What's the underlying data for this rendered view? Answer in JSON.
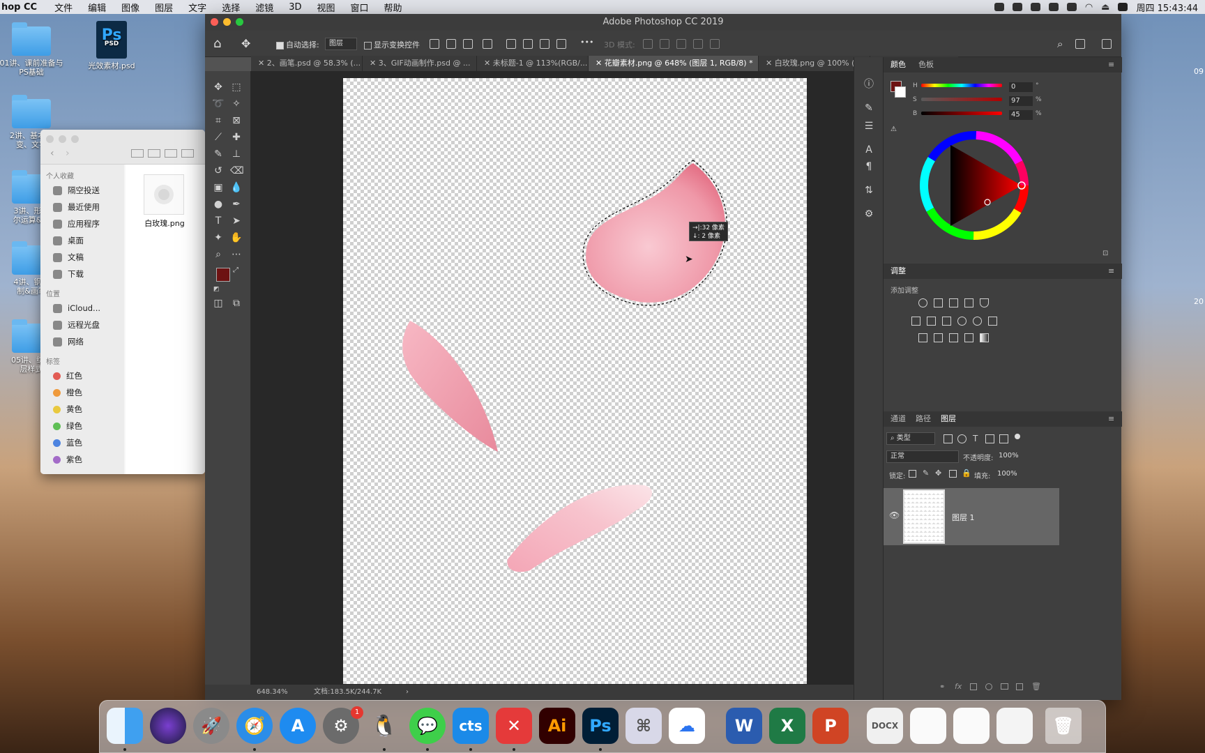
{
  "menubar": {
    "app_name": "hop CC",
    "items": [
      "文件",
      "编辑",
      "图像",
      "图层",
      "文字",
      "选择",
      "滤镜",
      "3D",
      "视图",
      "窗口",
      "帮助"
    ],
    "clock": "周四 15:43:44"
  },
  "desktop": {
    "items": [
      {
        "label": "01讲、课前准备与PS基础",
        "kind": "folder"
      },
      {
        "label": "光效素材.psd",
        "kind": "psd"
      },
      {
        "label": "2讲、基本技\n变、文字",
        "kind": "folder"
      },
      {
        "label": "3讲、形状\n尔运算&蒙",
        "kind": "folder"
      },
      {
        "label": "4讲、钢笔\n制&画笔",
        "kind": "folder"
      },
      {
        "label": "05讲、综合\n层样式",
        "kind": "folder"
      }
    ],
    "psd_badge": "Ps",
    "psd_sub": "PSD",
    "right_fragment_1": "09",
    "right_fragment_2": "20"
  },
  "finder": {
    "favorites_header": "个人收藏",
    "favorites": [
      "隔空投送",
      "最近使用",
      "应用程序",
      "桌面",
      "文稿",
      "下载"
    ],
    "locations_header": "位置",
    "locations": [
      "iCloud...",
      "远程光盘",
      "网络"
    ],
    "tags_header": "标签",
    "tags": [
      {
        "label": "红色",
        "color": "#e25b53"
      },
      {
        "label": "橙色",
        "color": "#ef9a3c"
      },
      {
        "label": "黄色",
        "color": "#e9c93f"
      },
      {
        "label": "绿色",
        "color": "#5fbf55"
      },
      {
        "label": "蓝色",
        "color": "#4d84e0"
      },
      {
        "label": "紫色",
        "color": "#a36bc8"
      }
    ],
    "file_name": "白玫瑰.png"
  },
  "photoshop": {
    "window_title": "Adobe Photoshop CC 2019",
    "options": {
      "auto_select_label": "自动选择:",
      "auto_select_target": "图层",
      "show_transform_label": "显示变换控件",
      "mode_3d_label": "3D 模式:"
    },
    "tabs": [
      "2、画笔.psd @ 58.3% (...",
      "3、GIF动画制作.psd @ ...",
      "未标题-1 @ 113%(RGB/...",
      "花瓣素材.png @ 648% (图层 1, RGB/8) *",
      "白玫瑰.png @ 100% (图..."
    ],
    "active_tab_index": 3,
    "measure_tooltip": [
      "→|:32 像素",
      "↓: 2 像素"
    ],
    "status_zoom": "648.34%",
    "status_doc": "文档:183.5K/244.7K",
    "foreground_color": "#6d1212",
    "background_color": "#ffffff",
    "color_panel": {
      "tabs": [
        "颜色",
        "色板"
      ],
      "h_label": "H",
      "h_value": "0",
      "h_unit": "°",
      "s_label": "S",
      "s_value": "97",
      "s_unit": "%",
      "b_label": "B",
      "b_value": "45",
      "b_unit": "%"
    },
    "adjust_panel": {
      "title": "调整",
      "subtitle": "添加调整"
    },
    "layers_panel": {
      "tabs": [
        "通道",
        "路径",
        "图层"
      ],
      "filter_kind": "类型",
      "blend_mode": "正常",
      "opacity_label": "不透明度:",
      "opacity_value": "100%",
      "lock_label": "锁定:",
      "fill_label": "填充:",
      "fill_value": "100%",
      "layers": [
        {
          "name": "图层 1",
          "visible": true
        }
      ]
    }
  },
  "dock": {
    "apps": [
      "Finder",
      "Siri",
      "Launchpad",
      "Safari",
      "App Store",
      "系统偏好设置",
      "QQ",
      "微信",
      "Camtasia",
      "XMind",
      "Illustrator",
      "Photoshop",
      "Alfred",
      "百度网盘",
      "Word",
      "Excel",
      "PowerPoint",
      "文稿",
      "预览",
      "截图",
      "屏幕录制",
      "废纸篓"
    ],
    "badge_count": "1"
  }
}
